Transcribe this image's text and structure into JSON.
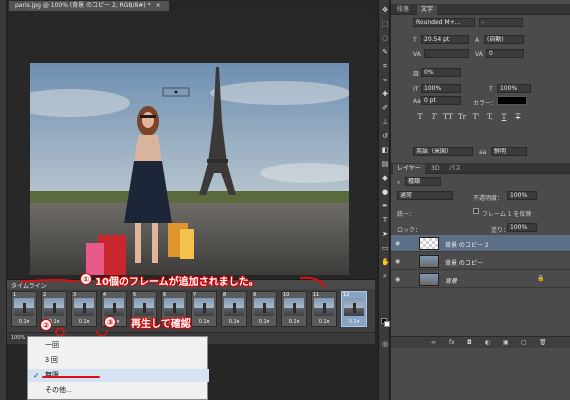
{
  "document": {
    "tab_title": "paris.jpg @ 100% (背景 のコピー 2, RGB/8#) *",
    "tab_close": "×"
  },
  "timeline": {
    "title": "タイムライン",
    "frames": [
      {
        "num": "1",
        "delay": "0.1▾"
      },
      {
        "num": "2",
        "delay": "0.1▾"
      },
      {
        "num": "3",
        "delay": "0.1▾"
      },
      {
        "num": "4",
        "delay": "0.1▾"
      },
      {
        "num": "5",
        "delay": "0.1▾"
      },
      {
        "num": "6",
        "delay": "0.1▾"
      },
      {
        "num": "7",
        "delay": "0.1▾"
      },
      {
        "num": "8",
        "delay": "0.1▾"
      },
      {
        "num": "9",
        "delay": "0.1▾"
      },
      {
        "num": "10",
        "delay": "0.1▾"
      },
      {
        "num": "11",
        "delay": "0.1▾"
      },
      {
        "num": "12",
        "delay": "0.1▾"
      }
    ],
    "selected_frame": 12,
    "zoom": "100%"
  },
  "annotations": {
    "step1_num": "①",
    "step1_text": "10個のフレームが追加されました。",
    "step2_num": "②",
    "step3_num": "③",
    "step3_text": "再生して確認"
  },
  "loop_menu": {
    "items": [
      "一回",
      "3 回",
      "無限",
      "その他..."
    ],
    "selected": "無限",
    "check": "✓"
  },
  "char_panel": {
    "tabs": [
      "段落",
      "文字"
    ],
    "font_family": "Rounded M+...",
    "font_style": "-",
    "font_size": "20.54 pt",
    "leading": "(自動)",
    "kerning": "",
    "tracking": "0",
    "scale": "0%",
    "vscale": "100%",
    "hscale": "100%",
    "baseline": "0 pt",
    "color_label": "カラー：",
    "color_value": "#000000",
    "style_buttons": [
      "T",
      "T",
      "TT",
      "Tr",
      "T'",
      "T,",
      "T",
      "T"
    ],
    "language": "英語（米国）",
    "aa": "鮮明"
  },
  "layers_panel": {
    "tabs": [
      "レイヤー",
      "3D",
      "パス"
    ],
    "kind": "種類",
    "blend": "通常",
    "opacity_label": "不透明度：",
    "opacity": "100%",
    "unify_label": "統一：",
    "propagate_label": "フレーム 1 を反映",
    "lock_label": "ロック：",
    "fill_label": "塗り：",
    "fill": "100%",
    "layers": [
      {
        "name": "背景 のコピー 2",
        "selected": true
      },
      {
        "name": "背景 のコピー",
        "selected": false
      },
      {
        "name": "背景",
        "selected": false
      }
    ]
  }
}
